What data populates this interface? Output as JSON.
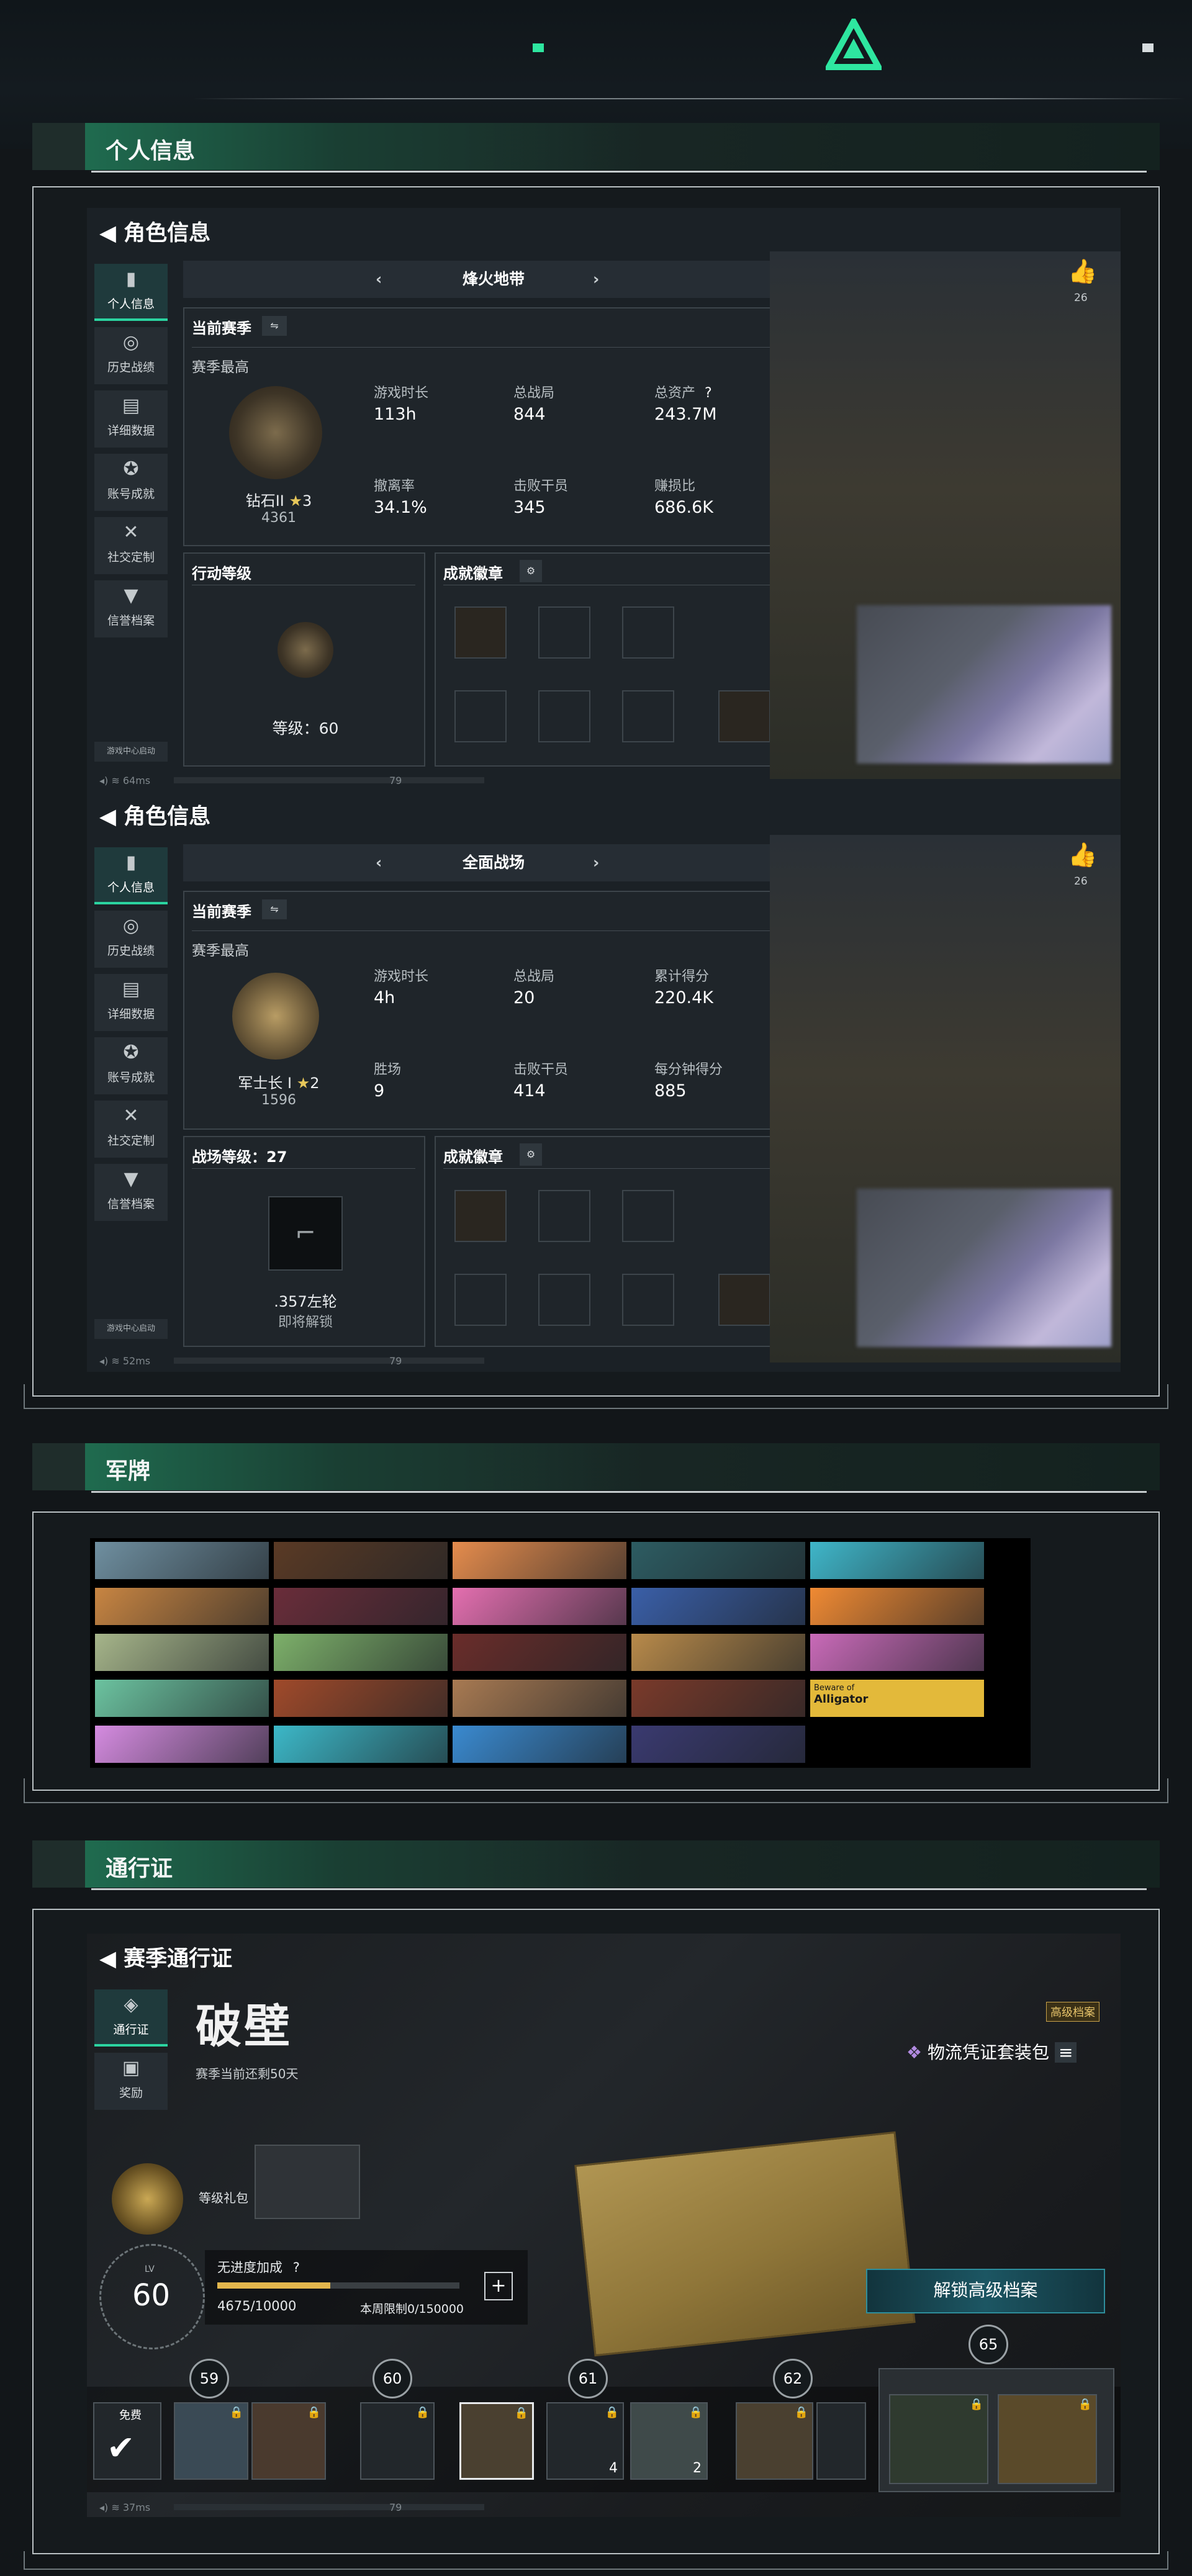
{
  "sections": {
    "personal": "个人信息",
    "tags": "军牌",
    "pass": "通行证"
  },
  "profile": {
    "title": "角色信息",
    "tabs": [
      "个人信息",
      "历史战绩",
      "详细数据",
      "账号成就",
      "社交定制",
      "信誉档案"
    ],
    "footer_hint": "游戏中心启动",
    "like_count": "26",
    "ping1": "64ms",
    "ping2": "52ms",
    "bar_num": "79"
  },
  "block1": {
    "mode": "烽火地带",
    "current_season": "当前赛季",
    "season_best": "赛季最高",
    "rank_name": "钻石II",
    "rank_stars": "3",
    "rank_points": "4361",
    "stats": [
      {
        "label": "游戏时长",
        "value": "113h"
      },
      {
        "label": "总战局",
        "value": "844"
      },
      {
        "label": "总资产",
        "value": "243.7M"
      },
      {
        "label": "撤离率",
        "value": "34.1%"
      },
      {
        "label": "击败干员",
        "value": "345"
      },
      {
        "label": "赚损比",
        "value": "686.6K"
      }
    ],
    "level_title": "行动等级",
    "level_text": "等级：60",
    "achievements": "成就徽章"
  },
  "block2": {
    "mode": "全面战场",
    "current_season": "当前赛季",
    "season_best": "赛季最高",
    "rank_name": "军士长 I",
    "rank_stars": "2",
    "rank_points": "1596",
    "stats": [
      {
        "label": "游戏时长",
        "value": "4h"
      },
      {
        "label": "总战局",
        "value": "20"
      },
      {
        "label": "累计得分",
        "value": "220.4K"
      },
      {
        "label": "胜场",
        "value": "9"
      },
      {
        "label": "击败干员",
        "value": "414"
      },
      {
        "label": "每分钟得分",
        "value": "885"
      }
    ],
    "level_title": "战场等级：27",
    "weapon": ".357左轮",
    "weapon_state": "即将解锁",
    "achievements": "成就徽章"
  },
  "tags_grid": {
    "alligator_line1": "Beware of",
    "alligator_line2": "Alligator",
    "colors": [
      "#6f8fa0",
      "#5a3a25",
      "#e58c4d",
      "#2d5c62",
      "#3fb6c9",
      "#c88542",
      "#6a2d3a",
      "#e46fb0",
      "#3a5fa8",
      "#f08a33",
      "#a6b58a",
      "#7db06a",
      "#6a2d2a",
      "#b88a4a",
      "#c96ab8",
      "#6cc3a0",
      "#a04a2a",
      "#a87a52",
      "#7a3a2a",
      "#e3b93a",
      "#d58be0",
      "#3cb8c8",
      "#3a8ad0",
      "#3a3a70"
    ]
  },
  "pass": {
    "title": "赛季通行证",
    "tabs": [
      "通行证",
      "奖励"
    ],
    "season_name": "破壁",
    "season_left": "赛季当前还剩50天",
    "premium_tag": "高级档案",
    "bundle": "物流凭证套装包",
    "gift_label": "等级礼包",
    "level": "60",
    "lv_label": "LV",
    "boost": "无进度加成",
    "boost_q": "?",
    "progress_text": "4675/10000",
    "progress_fraction": 0.4675,
    "weekly": "本周限制0/150000",
    "unlock_btn": "解锁高级档案",
    "free": "免费",
    "levels": [
      "59",
      "60",
      "61",
      "62",
      "65"
    ],
    "counts": [
      "4",
      "2"
    ],
    "ping": "37ms",
    "bar_num": "79"
  }
}
